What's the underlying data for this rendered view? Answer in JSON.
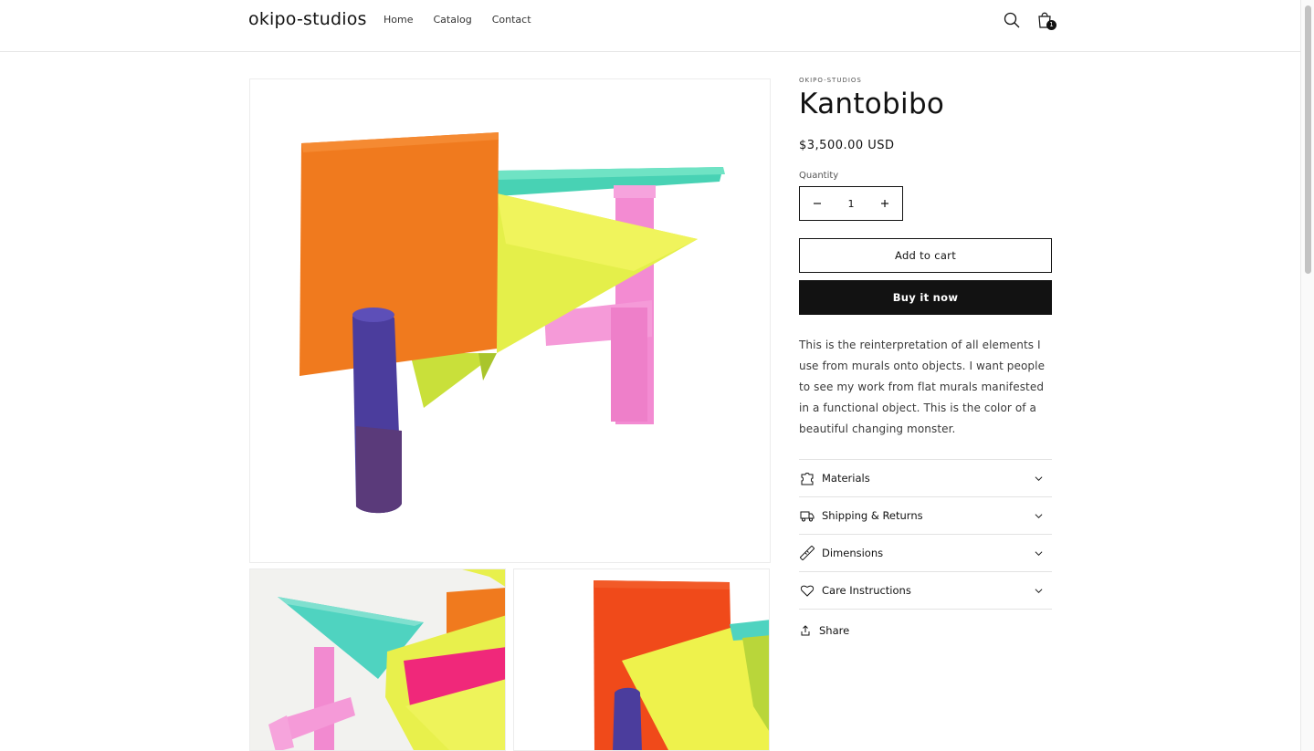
{
  "header": {
    "logo": "okipo-studios",
    "nav": [
      "Home",
      "Catalog",
      "Contact"
    ],
    "cart_count": "1"
  },
  "product": {
    "vendor": "OKIPO-STUDIOS",
    "title": "Kantobibo",
    "price": "$3,500.00 USD",
    "quantity_label": "Quantity",
    "quantity_value": "1",
    "add_to_cart": "Add to cart",
    "buy_now": "Buy it now",
    "description": "This is the reinterpretation of all elements I use from murals onto objects. I want people to see my work from flat murals manifested in a functional object. This is the color of a beautiful changing monster.",
    "accordions": [
      {
        "label": "Materials",
        "icon": "puzzle-icon"
      },
      {
        "label": "Shipping & Returns",
        "icon": "truck-icon"
      },
      {
        "label": "Dimensions",
        "icon": "ruler-icon"
      },
      {
        "label": "Care Instructions",
        "icon": "heart-icon"
      }
    ],
    "share": "Share"
  },
  "colors": {
    "text": "#121212",
    "orange": "#f27a1f",
    "lime": "#e5f24a",
    "teal": "#4fd4bf",
    "pink": "#f58ad0",
    "purple": "#4a3d9a",
    "magenta": "#f0287a",
    "red_orange": "#f24a1a"
  }
}
